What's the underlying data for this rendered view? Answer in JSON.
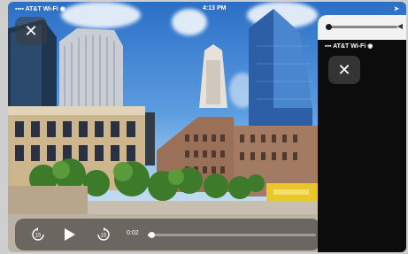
{
  "status_bar": {
    "carrier": "AT&T Wi-Fi",
    "time": "4:13 PM"
  },
  "side_panel": {
    "carrier": "AT&T Wi-Fi",
    "volume_level": 0.02
  },
  "player": {
    "elapsed": "0:02",
    "progress": 0.02,
    "skip_back_label": "15",
    "skip_forward_label": "15"
  },
  "icons": {
    "close": "close-icon",
    "play": "play-icon",
    "skip_back": "skip-back-15-icon",
    "skip_forward": "skip-forward-15-icon",
    "wifi": "wifi-icon",
    "location": "location-icon",
    "volume": "volume-icon"
  }
}
